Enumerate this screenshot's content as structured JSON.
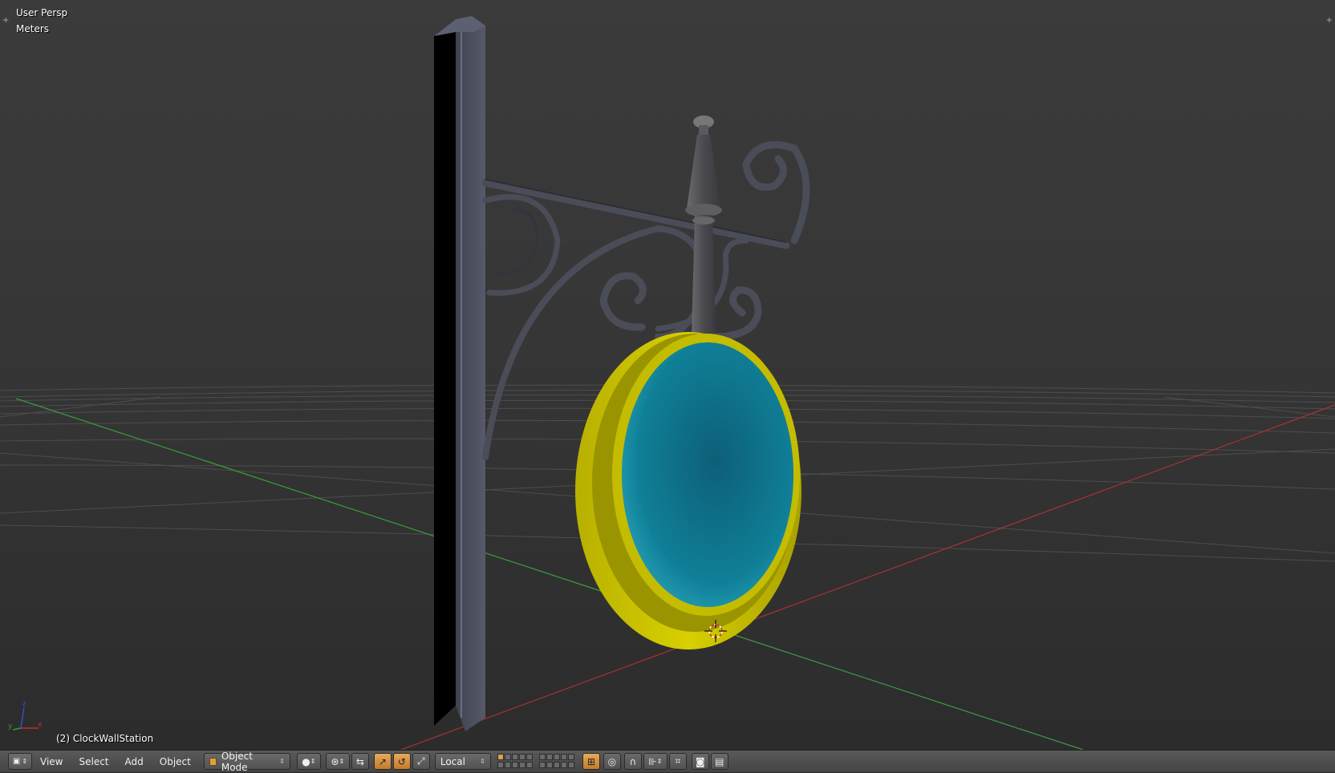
{
  "viewport": {
    "view_name": "User Persp",
    "unit_system": "Meters",
    "active_object": "(2) ClockWallStation",
    "axis_labels": {
      "x": "x",
      "y": "y",
      "z": "z"
    },
    "colors": {
      "frame": "#c8c000",
      "face": "#0f7f97",
      "post": "#4b4e5c",
      "bracket": "#4a4c58",
      "finial": "#5a5a5e",
      "x_axis": "#a83232",
      "y_axis": "#3e9b3e"
    }
  },
  "header": {
    "editor_type_icon": "view3d-icon",
    "menus": [
      "View",
      "Select",
      "Add",
      "Object"
    ],
    "mode": {
      "label": "Object Mode",
      "icon": "object-mode-cube-icon"
    },
    "viewport_shading_icon": "solid-sphere-icon",
    "pivot_icon": "pivot-point-icon",
    "transform_orientation": "Local",
    "manipulator_icons": [
      "manipulator-toggle-icon",
      "translate-icon",
      "rotate-icon",
      "scale-icon"
    ],
    "snap_icons": [
      "proportional-edit-icon",
      "snap-toggle-icon",
      "snap-target-icon"
    ],
    "render_icons": [
      "render-still-icon",
      "render-anim-icon"
    ]
  }
}
